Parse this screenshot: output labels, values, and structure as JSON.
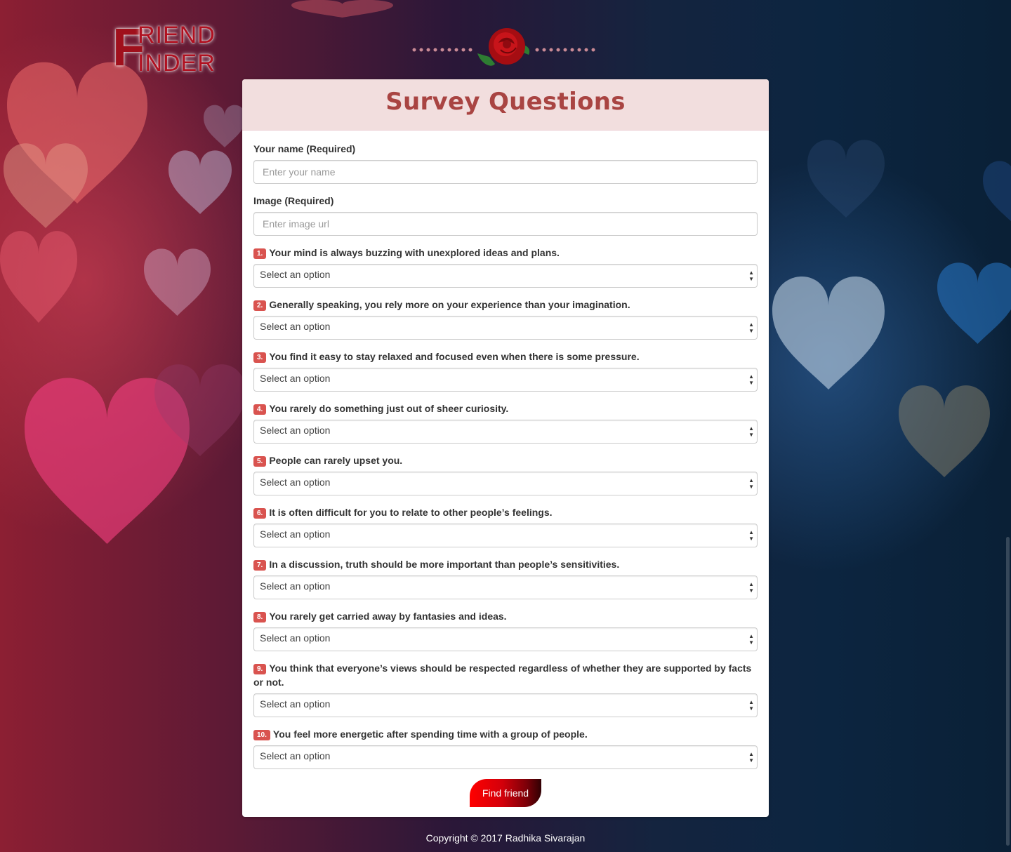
{
  "logo": {
    "line1": "RIEND",
    "line2": "INDER",
    "initial": "F"
  },
  "panel": {
    "title": "Survey Questions"
  },
  "form": {
    "name_label": "Your name (Required)",
    "name_placeholder": "Enter your name",
    "image_label": "Image (Required)",
    "image_placeholder": "Enter image url",
    "questions": [
      {
        "number": "1.",
        "text": "Your mind is always buzzing with unexplored ideas and plans.",
        "selected": "Select an option"
      },
      {
        "number": "2.",
        "text": "Generally speaking, you rely more on your experience than your imagination.",
        "selected": "Select an option"
      },
      {
        "number": "3.",
        "text": "You find it easy to stay relaxed and focused even when there is some pressure.",
        "selected": "Select an option"
      },
      {
        "number": "4.",
        "text": "You rarely do something just out of sheer curiosity.",
        "selected": "Select an option"
      },
      {
        "number": "5.",
        "text": "People can rarely upset you.",
        "selected": "Select an option"
      },
      {
        "number": "6.",
        "text": "It is often difficult for you to relate to other people’s feelings.",
        "selected": "Select an option"
      },
      {
        "number": "7.",
        "text": "In a discussion, truth should be more important than people’s sensitivities.",
        "selected": "Select an option"
      },
      {
        "number": "8.",
        "text": "You rarely get carried away by fantasies and ideas.",
        "selected": "Select an option"
      },
      {
        "number": "9.",
        "text": "You think that everyone’s views should be respected regardless of whether they are supported by facts or not.",
        "selected": "Select an option"
      },
      {
        "number": "10.",
        "text": "You feel more energetic after spending time with a group of people.",
        "selected": "Select an option"
      }
    ],
    "submit_label": "Find friend"
  },
  "footer": {
    "copyright": "Copyright © 2017 Radhika Sivarajan"
  },
  "colors": {
    "accent": "#a94442",
    "badge": "#d9534f",
    "panel_header": "#f2dede",
    "button": "#ff0000"
  }
}
